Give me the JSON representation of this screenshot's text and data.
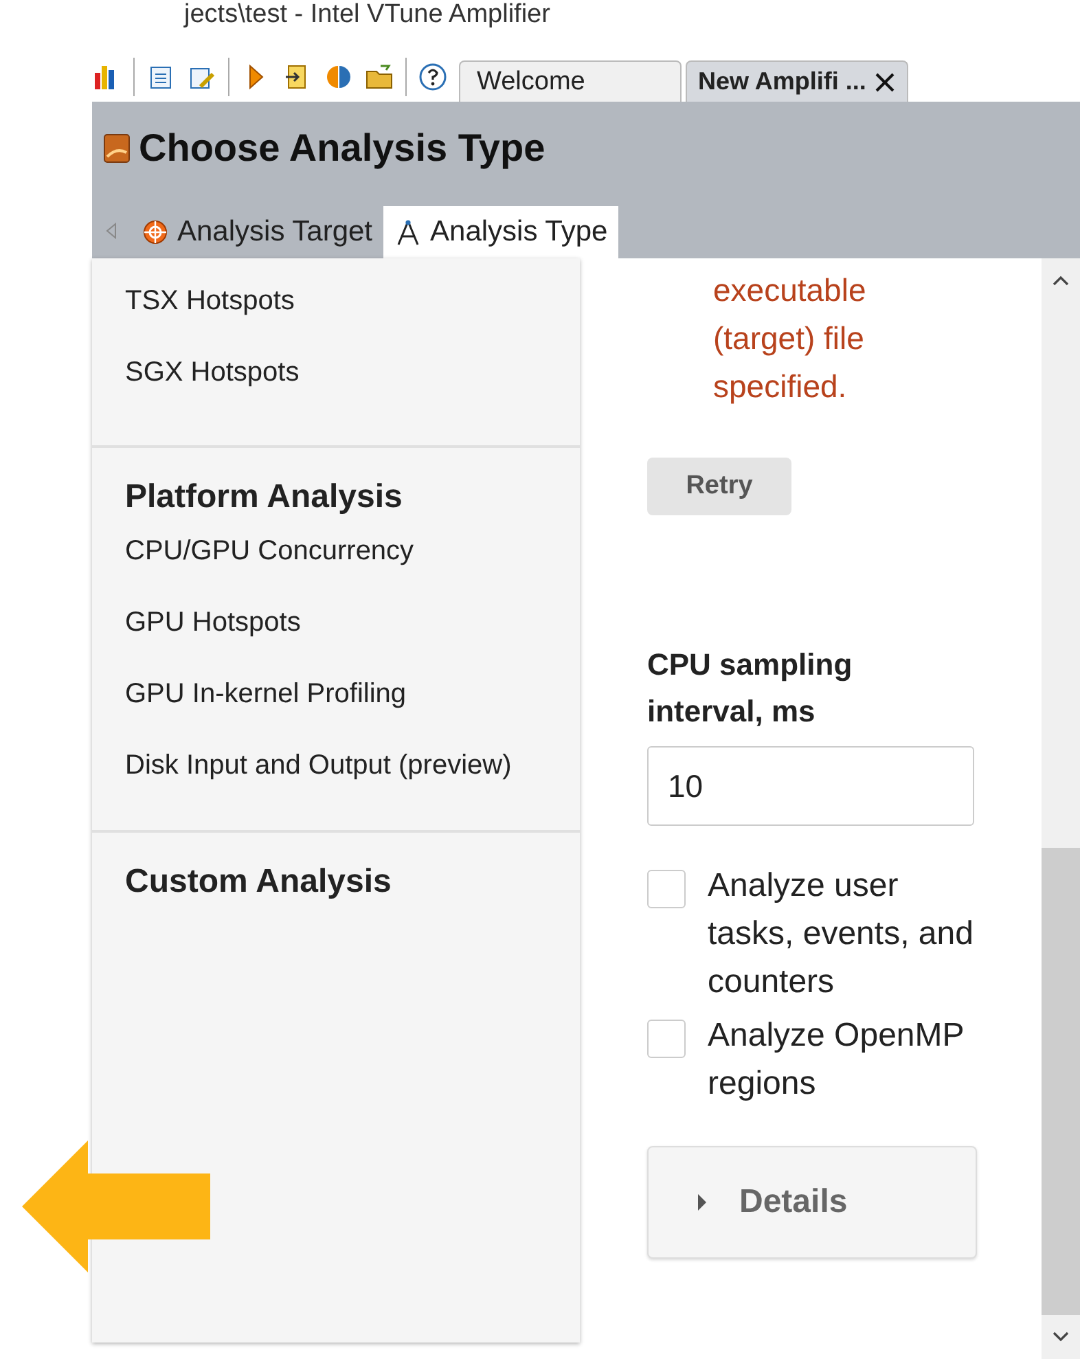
{
  "window": {
    "title": "jects\\test - Intel VTune Amplifier"
  },
  "editor_tabs": [
    {
      "label": "Welcome",
      "selected": false,
      "closable": false
    },
    {
      "label": "New Amplifi ...",
      "selected": true,
      "closable": true
    }
  ],
  "header": {
    "title": "Choose Analysis Type"
  },
  "breadcrumbs": [
    {
      "label": "Analysis Target",
      "kind": "target",
      "selected": false
    },
    {
      "label": "Analysis Type",
      "kind": "type",
      "selected": true
    }
  ],
  "sidebar": {
    "sections": [
      {
        "items": [
          "TSX Hotspots",
          "SGX Hotspots"
        ]
      },
      {
        "heading": "Platform Analysis",
        "items": [
          "CPU/GPU Concurrency",
          "GPU Hotspots",
          "GPU In-kernel Profiling",
          "Disk Input and Output (preview)"
        ]
      },
      {
        "heading": "Custom Analysis"
      }
    ]
  },
  "error_message": "executable (target) file specified.",
  "retry_button": "Retry",
  "sampling": {
    "label": "CPU sampling interval, ms",
    "value": "10"
  },
  "options": [
    {
      "label": "Analyze user tasks, events, and counters",
      "checked": false
    },
    {
      "label": "Analyze OpenMP regions",
      "checked": false
    }
  ],
  "details": {
    "label": "Details",
    "expanded": false
  }
}
